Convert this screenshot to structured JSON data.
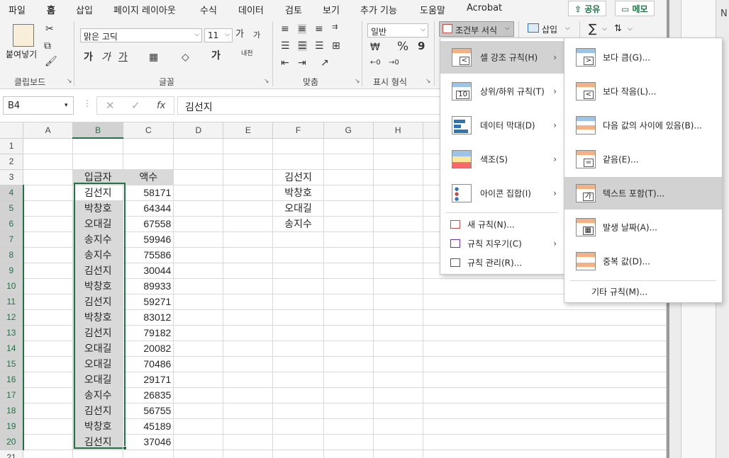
{
  "tabs": [
    "파일",
    "홈",
    "삽입",
    "페이지 레이아웃",
    "수식",
    "데이터",
    "검토",
    "보기",
    "추가 기능",
    "도움말",
    "Acrobat"
  ],
  "share_label": "공유",
  "memo_label": "메모",
  "right_header": "N",
  "ribbon": {
    "clipboard": {
      "paste": "붙여넣기",
      "group": "클립보드"
    },
    "font": {
      "name": "맑은 고딕",
      "size": "11",
      "grow": "가",
      "shrink": "가",
      "bold": "가",
      "italic": "가",
      "underline": "가",
      "phonetic": "내천",
      "group": "글꼴"
    },
    "align": {
      "group": "맞춤"
    },
    "number": {
      "format": "일반",
      "percent": "%",
      "comma": "9",
      "group": "표시 형식"
    },
    "styles": {
      "conditional": "조건부 서식"
    },
    "cells": {
      "insert": "삽입"
    },
    "editing": {
      "sum": "∑"
    }
  },
  "formula_bar": {
    "name_box": "B4",
    "fx": "fx",
    "content": "김선지"
  },
  "columns": [
    "A",
    "B",
    "C",
    "D",
    "E",
    "F",
    "G",
    "H"
  ],
  "rows": [
    "1",
    "2",
    "3",
    "4",
    "5",
    "6",
    "7",
    "8",
    "9",
    "10",
    "11",
    "12",
    "13",
    "14",
    "15",
    "16",
    "17",
    "18",
    "19",
    "20",
    "21"
  ],
  "table": {
    "header_b": "입금자",
    "header_c": "액수",
    "data": [
      [
        "김선지",
        "58171"
      ],
      [
        "박창호",
        "64344"
      ],
      [
        "오대길",
        "67558"
      ],
      [
        "송지수",
        "59946"
      ],
      [
        "송지수",
        "75586"
      ],
      [
        "김선지",
        "30044"
      ],
      [
        "박창호",
        "89933"
      ],
      [
        "김선지",
        "59271"
      ],
      [
        "박창호",
        "83012"
      ],
      [
        "김선지",
        "79182"
      ],
      [
        "오대길",
        "20082"
      ],
      [
        "오대길",
        "70486"
      ],
      [
        "오대길",
        "29171"
      ],
      [
        "송지수",
        "26835"
      ],
      [
        "김선지",
        "56755"
      ],
      [
        "박창호",
        "45189"
      ],
      [
        "김선지",
        "37046"
      ]
    ],
    "f_list": [
      "김선지",
      "박창호",
      "오대길",
      "송지수"
    ]
  },
  "cf_menu": {
    "items": [
      {
        "label": "셀 강조 규칙(H)"
      },
      {
        "label": "상위/하위 규칙(T)"
      },
      {
        "label": "데이터 막대(D)"
      },
      {
        "label": "색조(S)"
      },
      {
        "label": "아이콘 집합(I)"
      },
      {
        "label": "새 규칙(N)..."
      },
      {
        "label": "규칙 지우기(C)"
      },
      {
        "label": "규칙 관리(R)..."
      }
    ]
  },
  "sub_menu": {
    "items": [
      {
        "label": "보다 큼(G)..."
      },
      {
        "label": "보다 작음(L)..."
      },
      {
        "label": "다음 값의 사이에 있음(B)..."
      },
      {
        "label": "같음(E)..."
      },
      {
        "label": "텍스트 포함(T)..."
      },
      {
        "label": "발생 날짜(A)..."
      },
      {
        "label": "중복 값(D)..."
      }
    ],
    "more": "기타 규칙(M)..."
  },
  "colors": {
    "excel_green": "#217346",
    "highlight": "#d2d2d2",
    "cell_fill": "#d9d9d9"
  }
}
